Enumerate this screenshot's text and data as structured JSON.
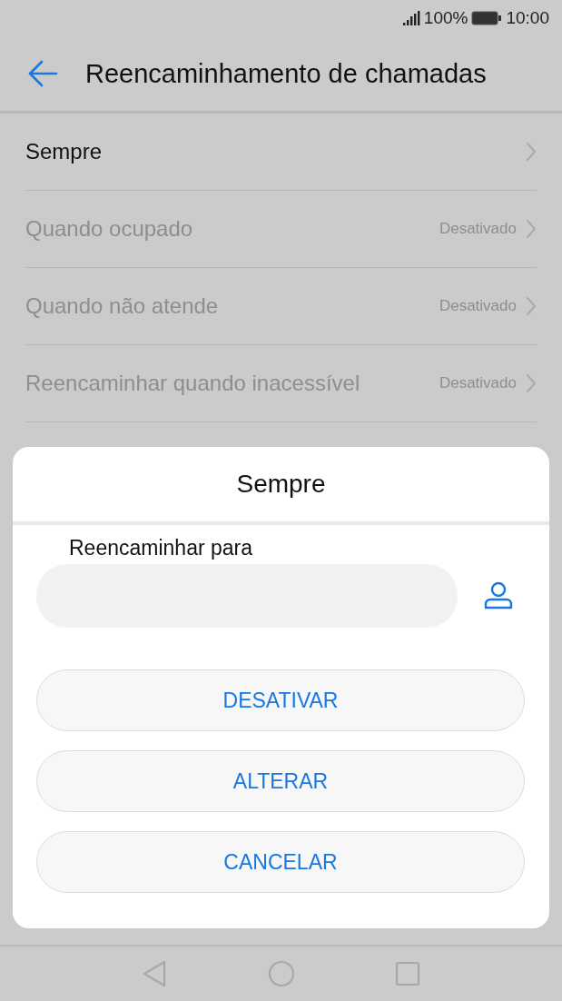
{
  "status_bar": {
    "battery_percent": "100%",
    "time": "10:00"
  },
  "header": {
    "title": "Reencaminhamento de chamadas"
  },
  "rows": [
    {
      "label": "Sempre",
      "disabled": false
    },
    {
      "label": "Quando ocupado",
      "value": "Desativado",
      "disabled": true
    },
    {
      "label": "Quando não atende",
      "value": "Desativado",
      "disabled": true
    },
    {
      "label": "Reencaminhar quando inacessível",
      "value": "Desativado",
      "disabled": true
    }
  ],
  "dialog": {
    "title": "Sempre",
    "field_label": "Reencaminhar para",
    "buttons": [
      "DESATIVAR",
      "ALTERAR",
      "CANCELAR"
    ]
  }
}
